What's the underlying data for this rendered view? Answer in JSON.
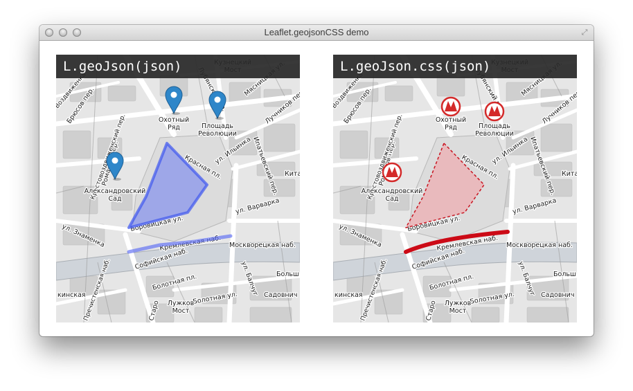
{
  "window": {
    "title": "Leaflet.geojsonCSS demo"
  },
  "maps": [
    {
      "header": "L.geoJson(json)",
      "style": {
        "polygon_fill": "#6b7cf2",
        "polygon_stroke": "#3d55f0",
        "line_color": "#5a6cf5",
        "marker": "pin-marker-icon",
        "marker_color": "#2e86c9"
      }
    },
    {
      "header": "L.geoJson.css(json)",
      "style": {
        "polygon_fill": "#f2a3a8",
        "polygon_stroke": "#c81420",
        "line_color": "#cc0a16",
        "marker": "metro-logo-icon",
        "marker_color": "#d42a2a"
      }
    }
  ],
  "labels": {
    "kuznetsky": [
      "Кузнецкий",
      "Мост"
    ],
    "okhotny": [
      "Охотный",
      "Ряд"
    ],
    "ploshchad": [
      "Площадь",
      "Революции"
    ],
    "alexandrovsky": [
      "Александровский",
      "Сад"
    ],
    "lubyanka_pr": "Лубянский пр.",
    "myasnitskaya": "Мясницкая ул.",
    "bryusov": "Брюсов пер.",
    "vozdvizhenka": "Воздвиженка",
    "ipatyevsky": "Ипатьевский пер.",
    "luchnikov": "Лучников пер.",
    "ilyinka": "ул. Ильинка",
    "krasnaya": "Красная пл.",
    "kitay": "Китай",
    "romanov": "Романов пер.",
    "krestovozdvizhensky": "Крестовоздвиженский пер.",
    "varvarka": "ул. Варварка",
    "znamenka": "ул. Знаменка",
    "borovitskaya": "Боровицкая ул.",
    "kremlevskaya": "Кремлевская наб.",
    "moskvoretskaya": "Москворецкая наб.",
    "sofiyskaya": "Софийская наб.",
    "bolotnaya_pl": "Болотная пл.",
    "bolotnaya_ul": "Болотная ул.",
    "balchug": "ул. Балчуг",
    "bolshaya": "Больш",
    "sadovnich": "Садовнич",
    "luzhkov": [
      "Лужков",
      "Мост"
    ],
    "kropotkinskaya": "кинская",
    "prechistenskaya": "Пречистенская наб.",
    "staro": "Старо"
  }
}
